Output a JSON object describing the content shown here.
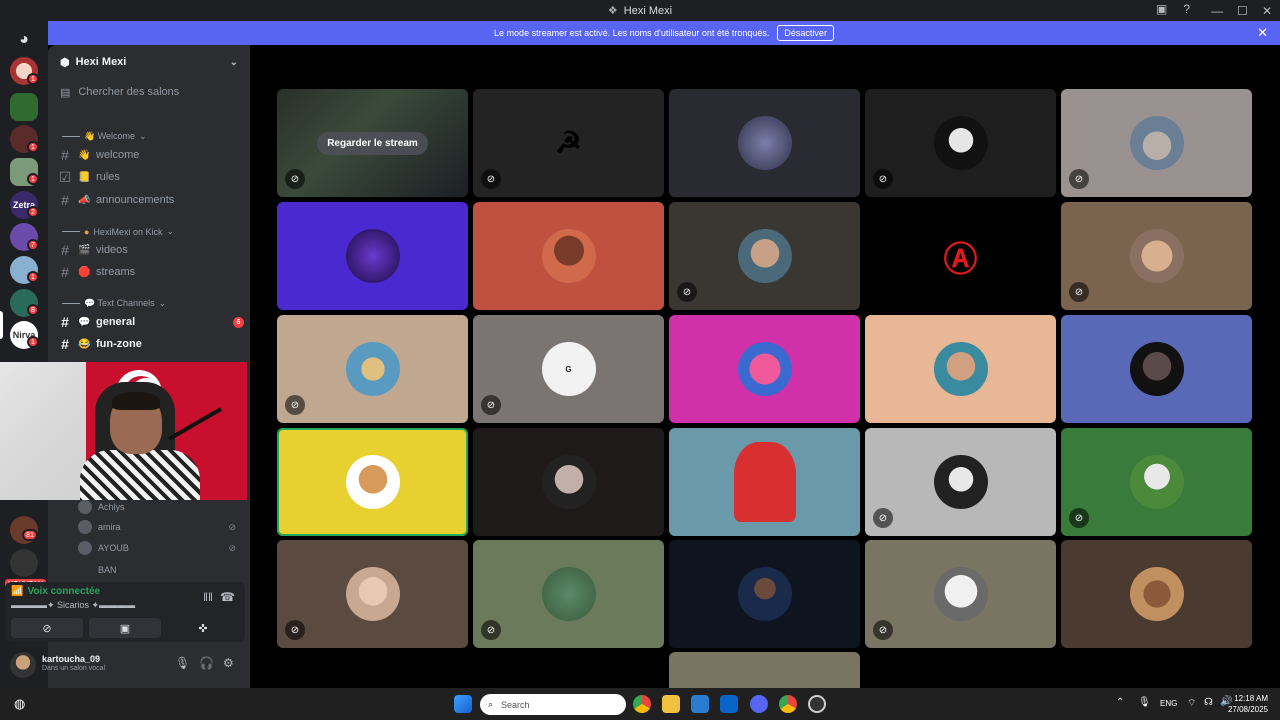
{
  "window": {
    "title": "Hexi Mexi"
  },
  "banner": {
    "message": "Le mode streamer est activé. Les noms d'utilisateur ont été tronqués.",
    "button": "Désactiver"
  },
  "server": {
    "name": "Hexi Mexi",
    "search": "Chercher des salons"
  },
  "categories": [
    {
      "label": "👋 Welcome"
    },
    {
      "label": "HexiMexi on Kick"
    },
    {
      "label": "💬 Text Channels"
    }
  ],
  "channels": [
    {
      "emoji": "👋",
      "name": "welcome"
    },
    {
      "emoji": "📒",
      "name": "rules"
    },
    {
      "emoji": "📣",
      "name": "announcements"
    },
    {
      "emoji": "🎬",
      "name": "videos"
    },
    {
      "emoji": "🛑",
      "name": "streams"
    },
    {
      "emoji": "💬",
      "name": "general",
      "badge": "6"
    },
    {
      "emoji": "😂",
      "name": "fun-zone"
    }
  ],
  "voice_users": [
    {
      "name": "Achlys"
    },
    {
      "name": "amira"
    },
    {
      "name": "AYOUB"
    },
    {
      "name": "BAN"
    }
  ],
  "rail_badges": [
    "1",
    "1",
    "1",
    "2",
    "1",
    "7",
    "1",
    "8",
    "1",
    "81"
  ],
  "rail_new": "NOUVEAU",
  "voice": {
    "status": "Voix connectée",
    "channel": "▬▬▬▬✦ Sicarios ✦▬▬▬▬"
  },
  "user": {
    "name": "kartoucha_09",
    "status": "Dans un salon vocal"
  },
  "stream": {
    "button": "Regarder le stream"
  },
  "taskbar": {
    "search": "Search",
    "lang": "ENG",
    "time": "12:18 AM",
    "date": "27/08/2025"
  },
  "icons": [
    "discord-icon",
    "search-icon",
    "hash-icon",
    "mic-icon",
    "headphones-icon",
    "gear-icon",
    "mute-icon",
    "camera-icon",
    "screen-share-icon",
    "close-icon",
    "chevron-down-icon",
    "windows-icon",
    "chrome-icon",
    "folder-icon",
    "wifi-icon",
    "volume-icon"
  ]
}
